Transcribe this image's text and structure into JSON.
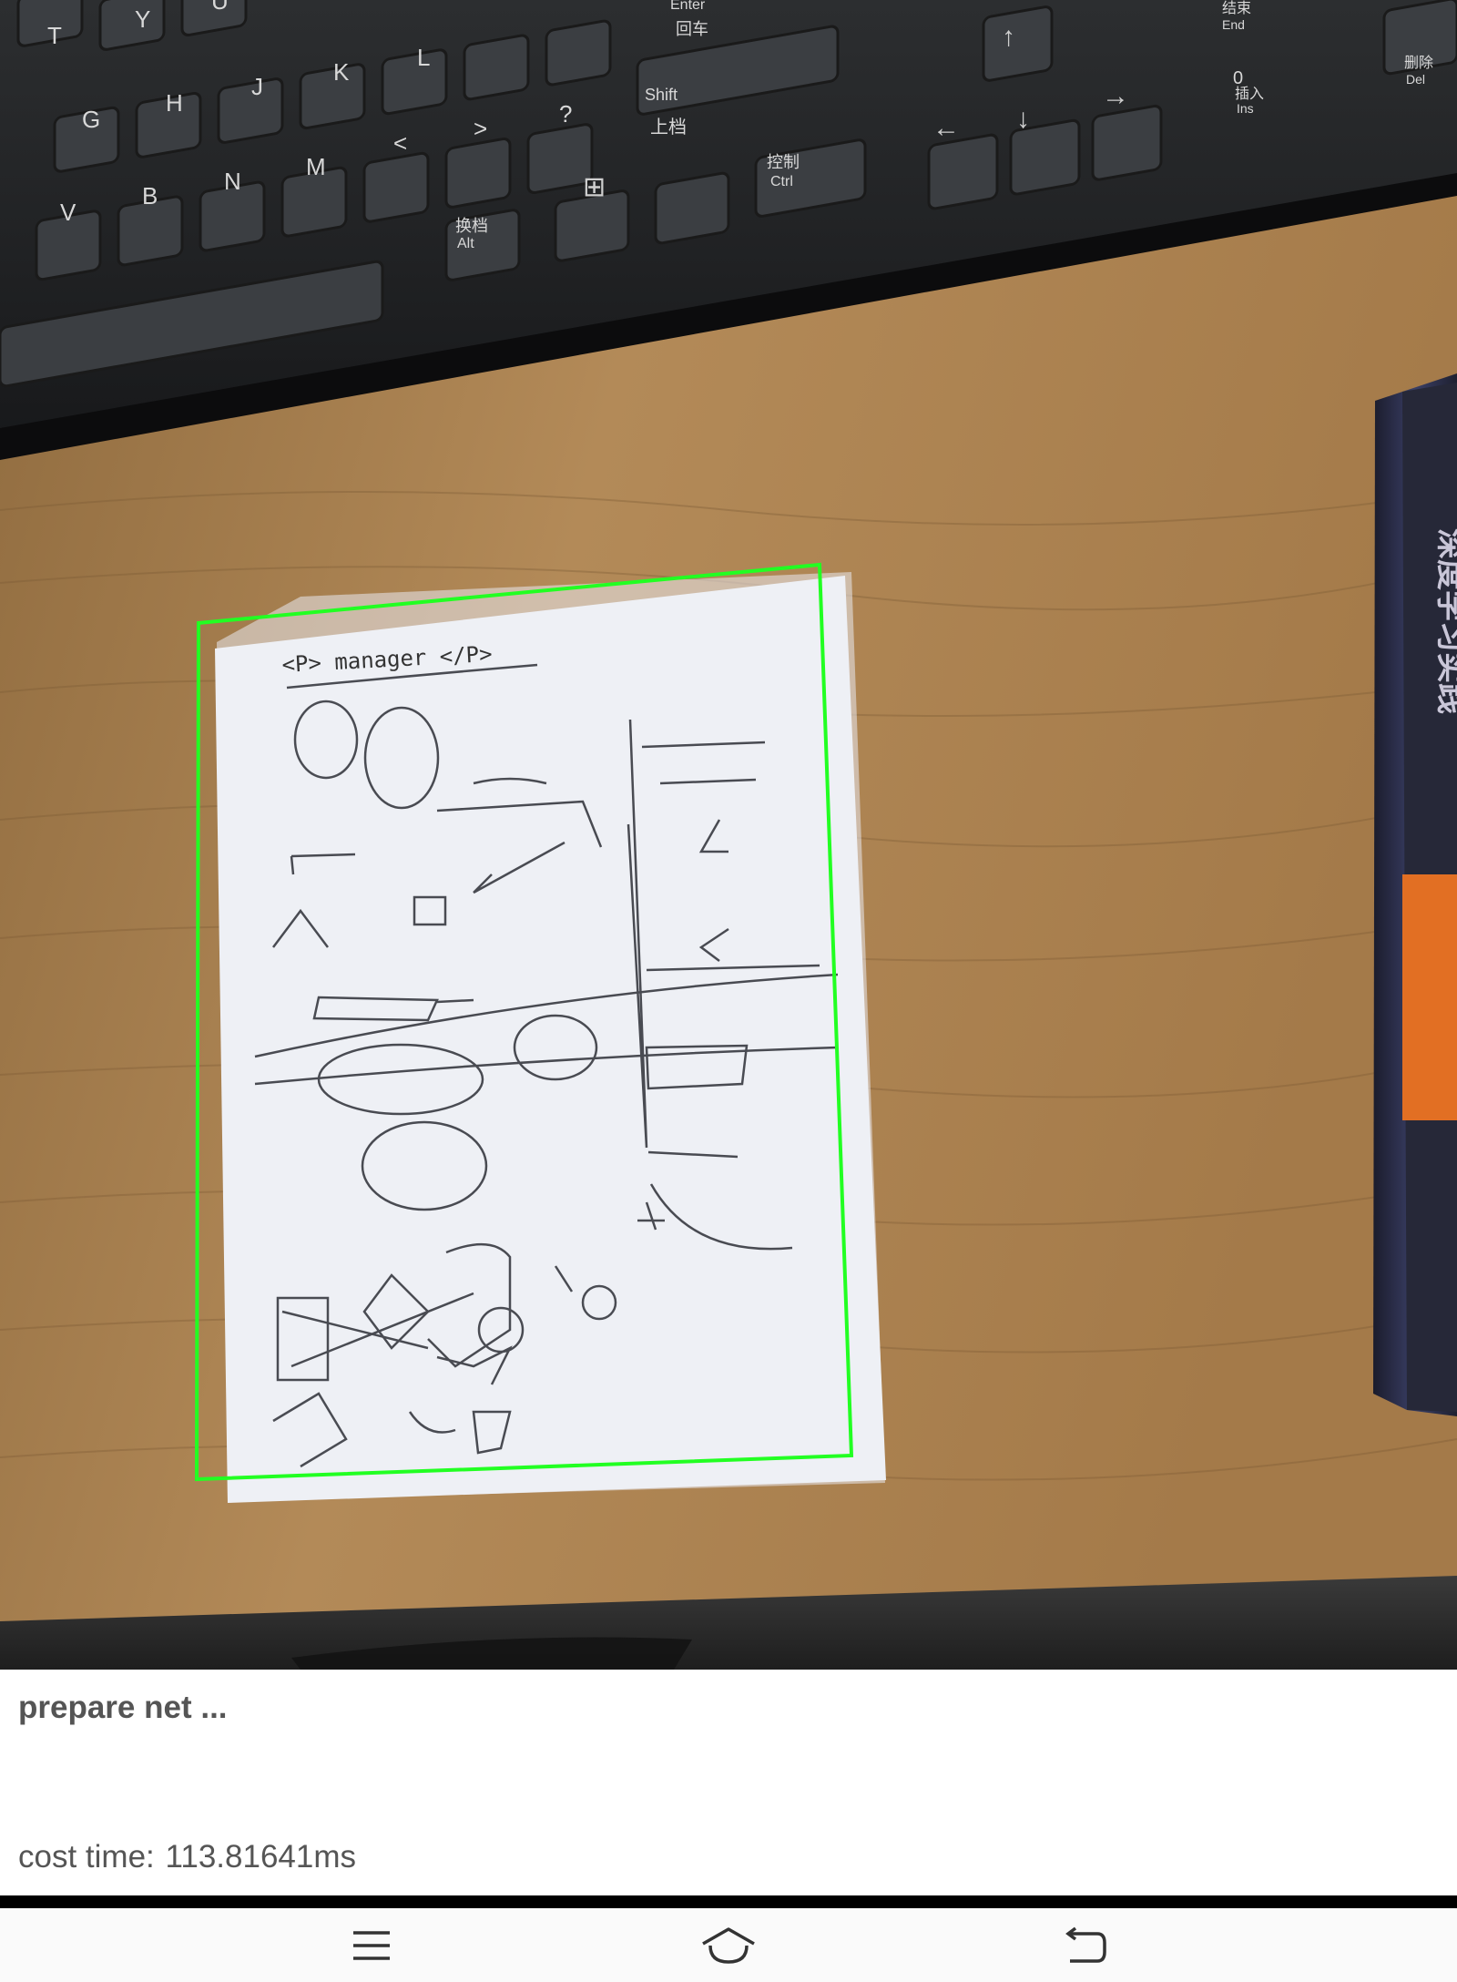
{
  "detection": {
    "status_text": "prepare net ...",
    "cost_label": "cost time:",
    "cost_value": "113.81641ms",
    "box_color": "#22ff22"
  },
  "keyboard": {
    "keys": [
      "Y",
      "U",
      "T",
      "G",
      "H",
      "J",
      "K",
      "L",
      "V",
      "B",
      "N",
      "M",
      "<",
      ">",
      "?",
      "Shift",
      "上档",
      "Enter",
      "回车",
      "换档",
      "Alt",
      "控制",
      "Ctrl",
      "结束",
      "End",
      "0",
      "插入",
      "Ins",
      "删除",
      "Del"
    ]
  },
  "book": {
    "spine_text": "深度学习实践"
  },
  "paper_note": {
    "header_text": "<P> manager </P>"
  },
  "nav_bar": {
    "menu_icon": "menu-icon",
    "home_icon": "home-icon",
    "back_icon": "back-icon"
  }
}
